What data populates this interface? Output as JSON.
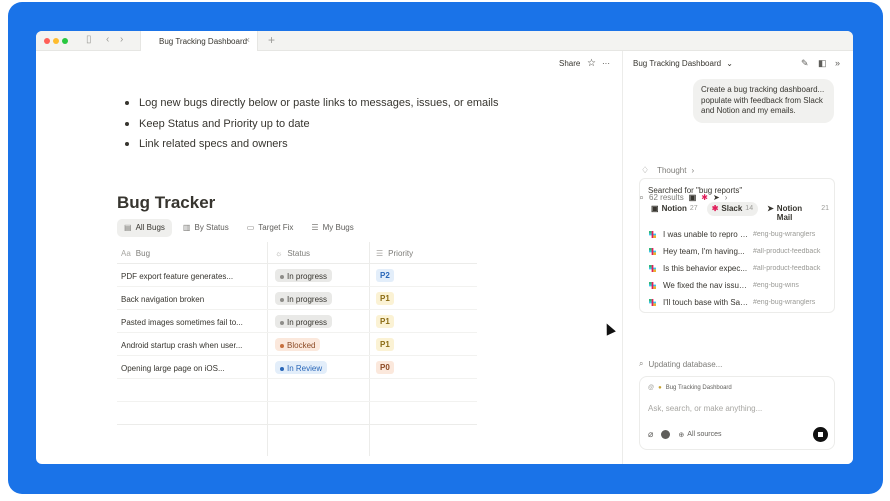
{
  "browser": {
    "tab_title": "Bug Tracking Dashboard",
    "tab_close": "×",
    "new_tab": "+"
  },
  "page": {
    "share_label": "Share",
    "star_icon": "star-icon",
    "more_label": "···",
    "bullets": [
      "Log new bugs directly below or paste links to messages, issues, or emails",
      "Keep Status and Priority up to date",
      "Link related specs and owners"
    ],
    "title": "Bug Tracker",
    "views": [
      {
        "label": "All Bugs",
        "icon": "▤"
      },
      {
        "label": "By Status",
        "icon": "▥"
      },
      {
        "label": "Target Fix",
        "icon": "▭"
      },
      {
        "label": "My Bugs",
        "icon": "☰"
      }
    ],
    "table": {
      "columns": [
        {
          "label": "Bug",
          "icon": "Aa"
        },
        {
          "label": "Status",
          "icon": "☼"
        },
        {
          "label": "Priority",
          "icon": "☰"
        }
      ],
      "rows": [
        {
          "name": "PDF export feature generates...",
          "status": "In progress",
          "priority": "P2"
        },
        {
          "name": "Back navigation broken",
          "status": "In progress",
          "priority": "P1"
        },
        {
          "name": "Pasted images sometimes fail to...",
          "status": "In progress",
          "priority": "P1"
        },
        {
          "name": "Android startup crash when user...",
          "status": "Blocked",
          "priority": "P1"
        },
        {
          "name": "Opening large page on iOS...",
          "status": "In Review",
          "priority": "P0"
        }
      ]
    }
  },
  "assistant": {
    "title": "Bug Tracking Dashboard",
    "title_chevron": "⌄",
    "user_message": "Create a bug tracking dashboard... populate with feedback from Slack and Notion and my emails.",
    "thought_label": "Thought",
    "results_label": "62 results",
    "search_query": "Searched for \"bug reports\"",
    "sources": [
      {
        "name": "Notion",
        "count": "27"
      },
      {
        "name": "Slack",
        "count": "14"
      },
      {
        "name": "Notion Mail",
        "count": "21"
      }
    ],
    "messages": [
      {
        "text": "I was unable to repro th...",
        "channel": "#eng-bug-wranglers"
      },
      {
        "text": "Hey team, I'm having...",
        "channel": "#all-product-feedback"
      },
      {
        "text": "Is this behavior expec...",
        "channel": "#all-product-feedback"
      },
      {
        "text": "We fixed the nav issue by m...",
        "channel": "#eng-bug-wins"
      },
      {
        "text": "I'll touch base with Sam...",
        "channel": "#eng-bug-wranglers"
      }
    ],
    "status_text": "Updating database...",
    "composer": {
      "context_label": "Bug Tracking Dashboard",
      "placeholder": "Ask, search, or make anything...",
      "sources_label": "All sources"
    }
  },
  "colors": {
    "brand_blue": "#1a73e8",
    "in_progress_bg": "#e9e9e7",
    "blocked_bg": "#fbe8dc",
    "in_review_bg": "#e3eefa",
    "p2_bg": "#e3eefa",
    "p1_bg": "#fbf2d4",
    "p0_bg": "#fbe8dc"
  }
}
